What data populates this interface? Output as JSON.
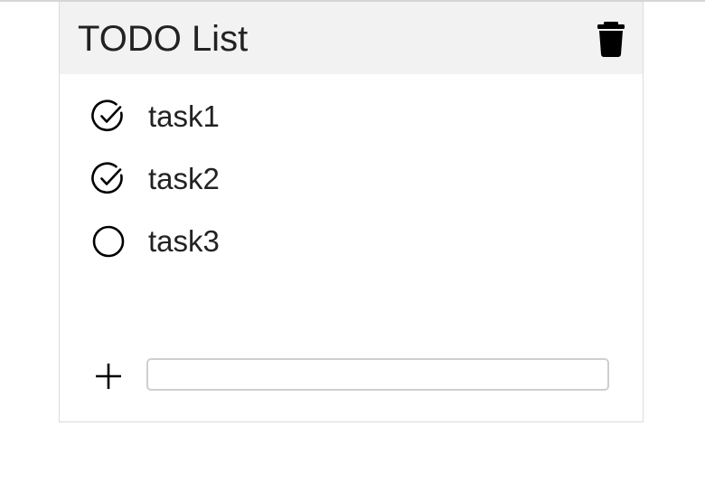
{
  "header": {
    "title": "TODO List",
    "delete_icon": "trash-icon"
  },
  "tasks": [
    {
      "label": "task1",
      "done": true,
      "icon": "check-circle-icon"
    },
    {
      "label": "task2",
      "done": true,
      "icon": "check-circle-icon"
    },
    {
      "label": "task3",
      "done": false,
      "icon": "circle-icon"
    }
  ],
  "add_task": {
    "icon": "plus-icon",
    "value": "",
    "placeholder": ""
  }
}
